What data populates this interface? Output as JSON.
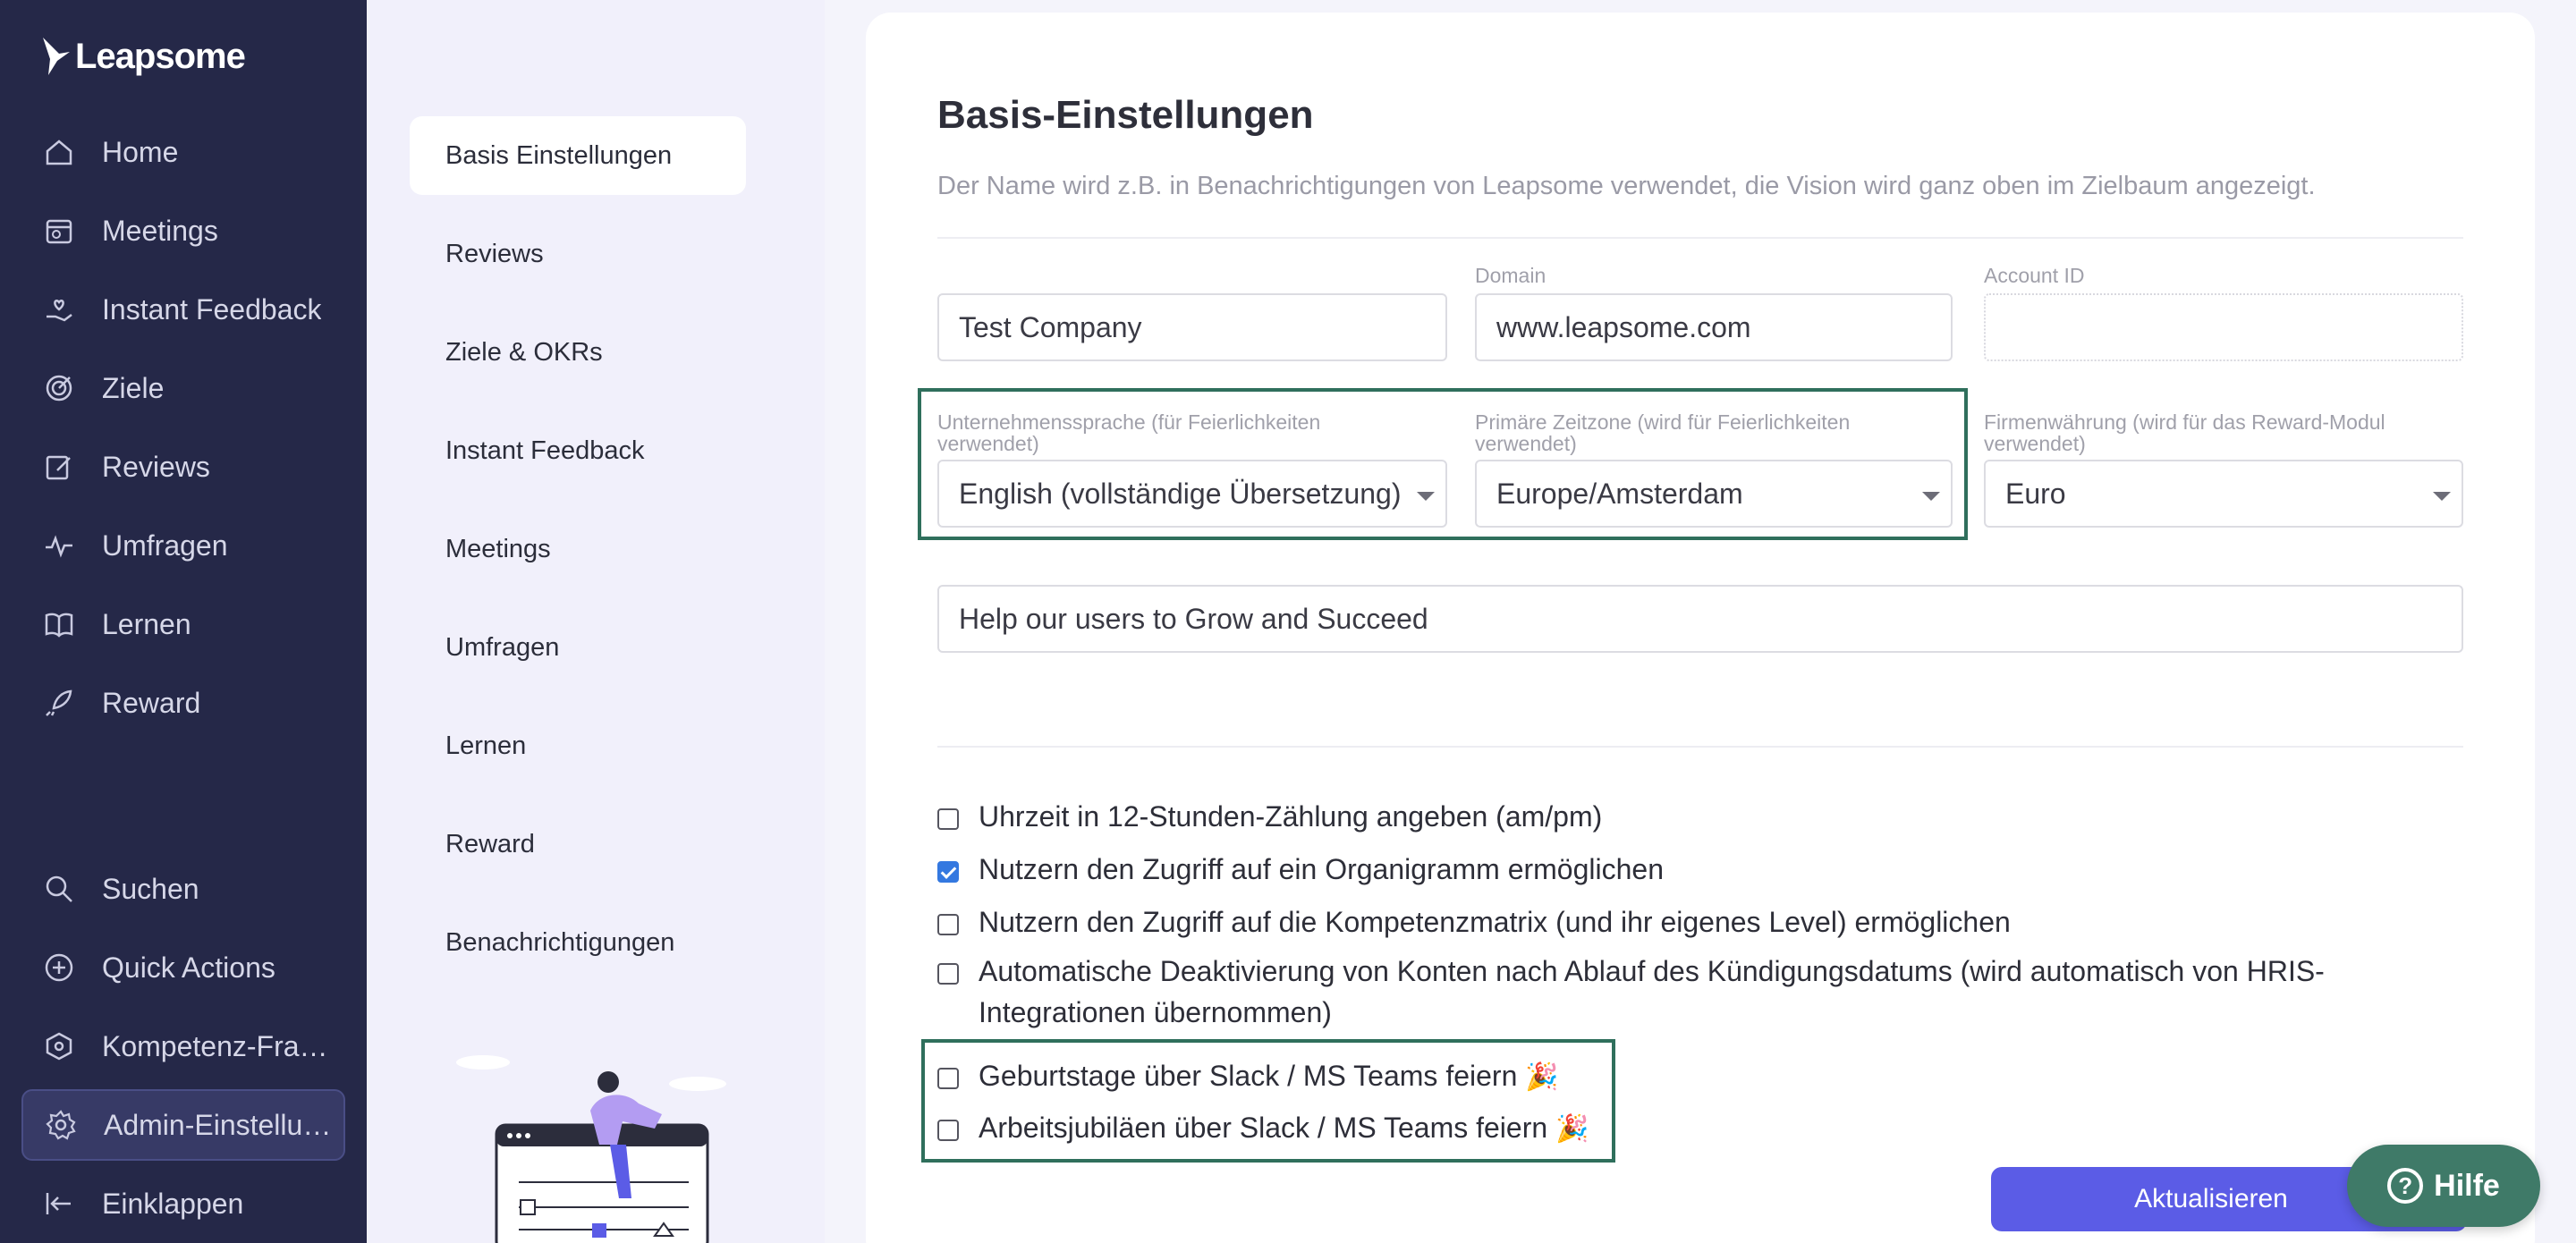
{
  "app": {
    "brand": "Leapsome"
  },
  "sidebar": {
    "items": [
      {
        "label": "Home",
        "icon": "home-icon"
      },
      {
        "label": "Meetings",
        "icon": "calendar-icon"
      },
      {
        "label": "Instant Feedback",
        "icon": "hand-heart-icon"
      },
      {
        "label": "Ziele",
        "icon": "target-icon"
      },
      {
        "label": "Reviews",
        "icon": "edit-icon"
      },
      {
        "label": "Umfragen",
        "icon": "pulse-icon"
      },
      {
        "label": "Lernen",
        "icon": "book-icon"
      },
      {
        "label": "Reward",
        "icon": "rocket-icon"
      }
    ],
    "bottom_items": [
      {
        "label": "Suchen",
        "icon": "search-icon"
      },
      {
        "label": "Quick Actions",
        "icon": "plus-circle-icon"
      },
      {
        "label": "Kompetenz-Framework",
        "icon": "network-icon"
      },
      {
        "label": "Admin-Einstellungen",
        "icon": "gear-icon",
        "active": true
      },
      {
        "label": "Einklappen",
        "icon": "collapse-icon"
      }
    ]
  },
  "submenu": {
    "items": [
      {
        "label": "Basis Einstellungen",
        "active": true
      },
      {
        "label": "Reviews"
      },
      {
        "label": "Ziele & OKRs"
      },
      {
        "label": "Instant Feedback"
      },
      {
        "label": "Meetings"
      },
      {
        "label": "Umfragen"
      },
      {
        "label": "Lernen"
      },
      {
        "label": "Reward"
      },
      {
        "label": "Benachrichtigungen"
      }
    ]
  },
  "main": {
    "title": "Basis-Einstellungen",
    "description": "Der Name wird z.B. in Benachrichtigungen von Leapsome verwendet, die Vision wird ganz oben im Zielbaum angezeigt.",
    "company_name": {
      "value": "Test Company"
    },
    "domain": {
      "label": "Domain",
      "value": "www.leapsome.com"
    },
    "account_id": {
      "label": "Account ID",
      "value": ""
    },
    "language": {
      "label": "Unternehmenssprache (für Feierlichkeiten verwendet)",
      "value": "English (vollständige Übersetzung)"
    },
    "timezone": {
      "label": "Primäre Zeitzone (wird für Feierlichkeiten verwendet)",
      "value": "Europe/Amsterdam"
    },
    "currency": {
      "label": "Firmenwährung (wird für das Reward-Modul verwendet)",
      "value": "Euro"
    },
    "vision": {
      "value": "Help our users to Grow and Succeed"
    },
    "checkboxes": [
      {
        "label": "Uhrzeit in 12-Stunden-Zählung angeben (am/pm)",
        "checked": false
      },
      {
        "label": "Nutzern den Zugriff auf ein Organigramm ermöglichen",
        "checked": true
      },
      {
        "label": "Nutzern den Zugriff auf die Kompetenzmatrix (und ihr eigenes Level) ermöglichen",
        "checked": false
      },
      {
        "label": "Automatische Deaktivierung von Konten nach Ablauf des Kündigungsdatums (wird automatisch von HRIS-Integrationen übernommen)",
        "checked": false
      },
      {
        "label": "Geburtstage über Slack / MS Teams feiern",
        "emoji": "🎉",
        "checked": false
      },
      {
        "label": "Arbeitsjubiläen über Slack / MS Teams feiern",
        "emoji": "🎉",
        "checked": false
      }
    ],
    "update_button": "Aktualisieren"
  },
  "help": {
    "label": "Hilfe",
    "icon_glyph": "?"
  },
  "colors": {
    "sidebar_bg": "#252848",
    "submenu_bg": "#f1f0fb",
    "highlight_border": "#2f6f5c",
    "primary_button": "#5b5ce6",
    "help_button": "#3f7a68",
    "checkbox_checked": "#3478e0"
  }
}
